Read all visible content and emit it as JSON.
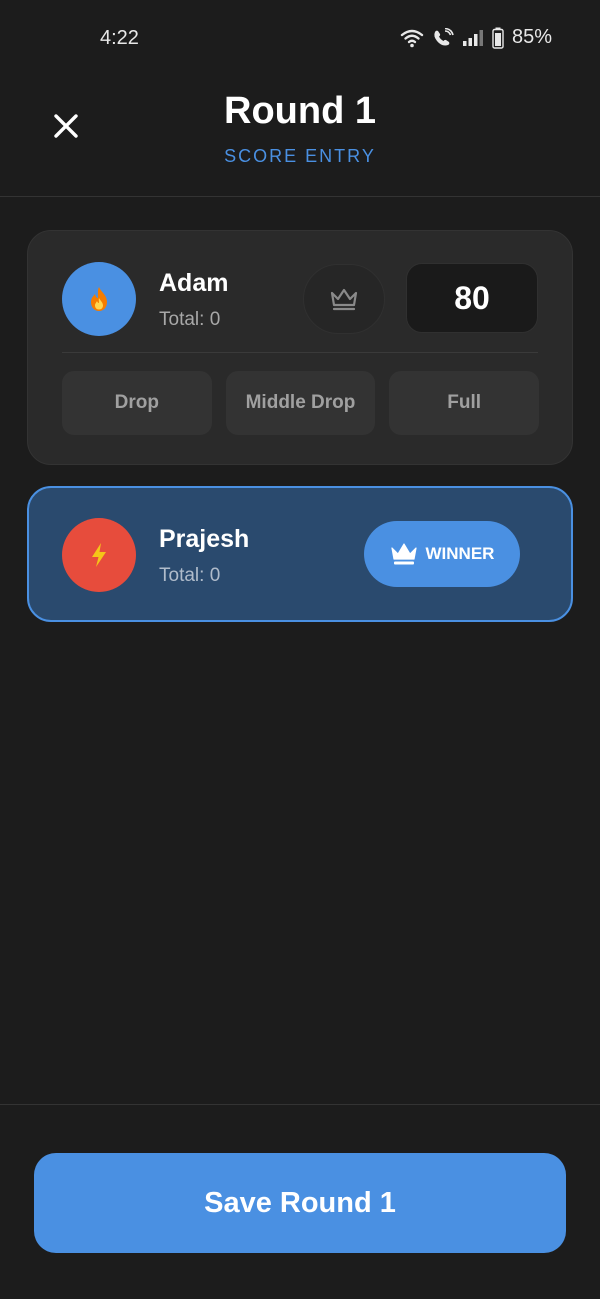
{
  "status_bar": {
    "time": "4:22",
    "battery": "85%",
    "icons": [
      "wifi-icon",
      "wifi-call-icon",
      "signal-icon",
      "battery-icon"
    ]
  },
  "header": {
    "close_icon": "close-icon",
    "title": "Round 1",
    "subtitle": "SCORE ENTRY"
  },
  "players": [
    {
      "name": "Adam",
      "total": "Total: 0",
      "avatar_icon": "fire-icon",
      "avatar_color": "#4a90e2",
      "score": "80",
      "crown_icon": "crown-outline-icon",
      "options": [
        "Drop",
        "Middle Drop",
        "Full"
      ]
    },
    {
      "name": "Prajesh",
      "total": "Total: 0",
      "avatar_icon": "lightning-icon",
      "avatar_color": "#e74c3c",
      "winner_label": "WINNER",
      "winner_icon": "crown-filled-icon"
    }
  ],
  "footer": {
    "save_label": "Save Round 1"
  },
  "colors": {
    "accent": "#4a90e2",
    "background": "#1c1c1c",
    "card": "#2a2a2a",
    "winner_card": "#2a4a6e"
  }
}
